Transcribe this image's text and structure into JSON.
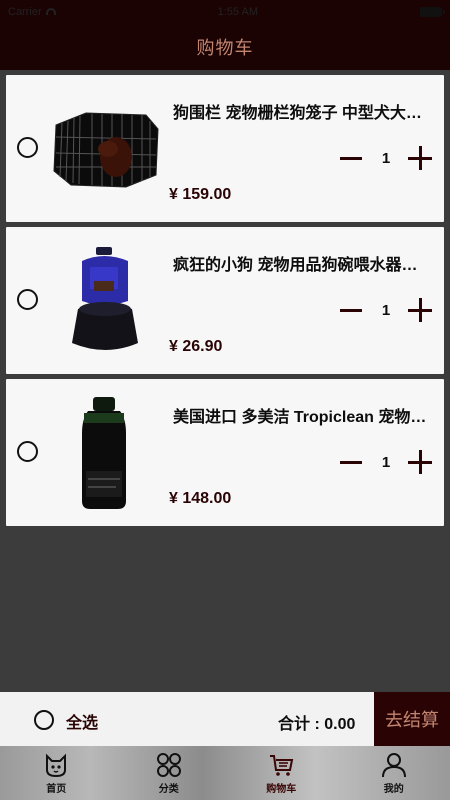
{
  "status_bar": {
    "carrier": "Carrier",
    "time": "1:55 AM"
  },
  "navbar": {
    "title": "购物车"
  },
  "cart_items": [
    {
      "name": "狗围栏 宠物栅栏狗笼子 中型犬大型犬",
      "quantity": "1",
      "price": "¥ 159.00",
      "image_icon": "dog-fence-image"
    },
    {
      "name": "疯狂的小狗 宠物用品狗碗喂水器自动饮水器",
      "quantity": "1",
      "price": "¥ 26.90",
      "image_icon": "water-dispenser-image"
    },
    {
      "name": "美国进口 多美洁 Tropiclean 宠物香波",
      "quantity": "1",
      "price": "¥ 148.00",
      "image_icon": "shampoo-bottle-image"
    }
  ],
  "checkout": {
    "select_all_label": "全选",
    "total_label": "合计 : 0.00",
    "checkout_button_label": "去结算"
  },
  "tabbar": {
    "tabs": [
      {
        "label": "首页",
        "icon": "cat-home-icon"
      },
      {
        "label": "分类",
        "icon": "grid-category-icon"
      },
      {
        "label": "购物车",
        "icon": "cart-icon"
      },
      {
        "label": "我的",
        "icon": "user-icon"
      }
    ],
    "active_index": 2
  },
  "colors": {
    "navbar_bg": "#1b0303",
    "accent_dark": "#2a0404",
    "accent_text": "#c28570",
    "page_bg": "#3c3c3c"
  }
}
